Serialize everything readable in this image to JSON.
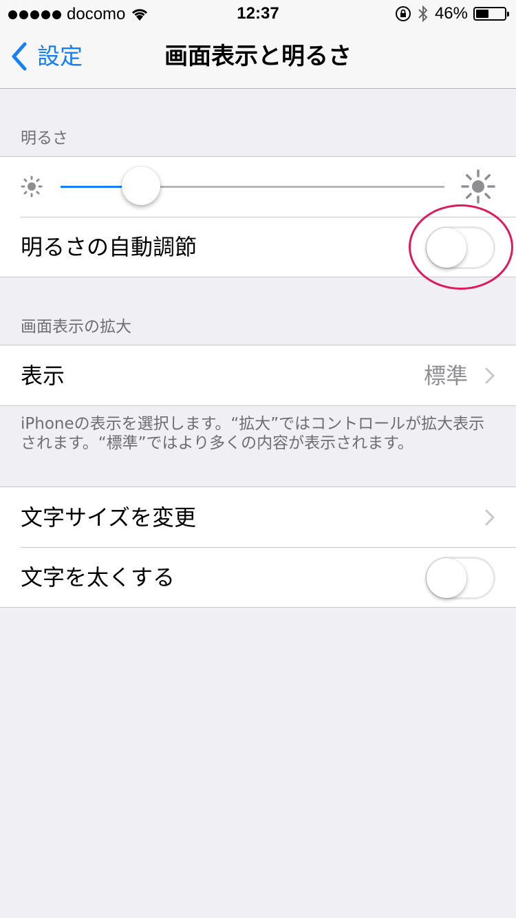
{
  "status_bar": {
    "carrier": "docomo",
    "time": "12:37",
    "battery_percent": "46%",
    "battery_level": 0.46,
    "icons": [
      "signal-dots-icon",
      "wifi-icon",
      "rotation-lock-icon",
      "bluetooth-icon",
      "battery-icon"
    ]
  },
  "nav": {
    "back_label": "設定",
    "title": "画面表示と明るさ"
  },
  "brightness_section": {
    "header": "明るさ",
    "slider_level": 0.21,
    "auto_brightness_label": "明るさの自動調節",
    "auto_brightness_on": false
  },
  "zoom_section": {
    "header": "画面表示の拡大",
    "view_label": "表示",
    "view_value": "標準",
    "footer": "iPhoneの表示を選択します。“拡大”ではコントロールが拡大表示されます。“標準”ではより多くの内容が表示されます。"
  },
  "text_section": {
    "text_size_label": "文字サイズを変更",
    "bold_text_label": "文字を太くする",
    "bold_text_on": false
  },
  "colors": {
    "accent": "#157efb",
    "background": "#efeff4",
    "annotation": "#e0195a"
  }
}
